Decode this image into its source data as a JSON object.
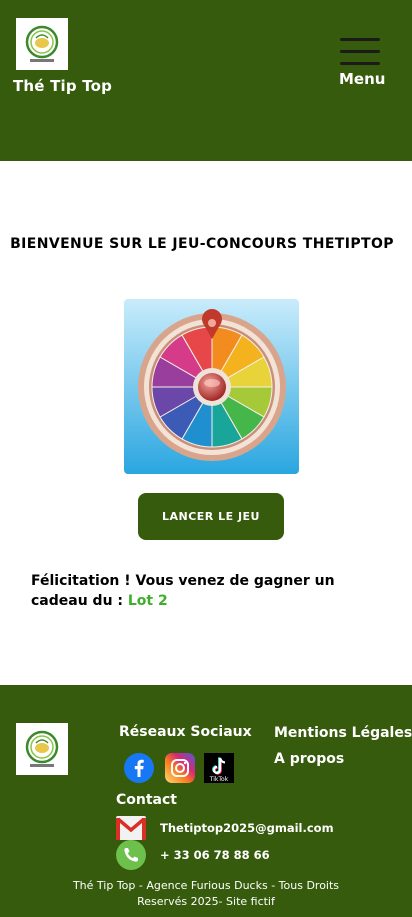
{
  "header": {
    "brand": "Thé Tip Top",
    "menu_label": "Menu"
  },
  "main": {
    "title": "Bienvenue sur le jeu-concours TheTipTop",
    "play_button": "Lancer le jeu",
    "result_prefix": "Félicitation ! Vous venez de gagner un cadeau du : ",
    "result_prize": "Lot 2"
  },
  "footer": {
    "social_heading": "Réseaux Sociaux",
    "social_icons": [
      "facebook-icon",
      "instagram-icon",
      "tiktok-icon"
    ],
    "tiktok_label": "TikTok",
    "legal_link": "Mentions Légales",
    "about_link": "A propos",
    "contact_heading": "Contact",
    "email": "Thetiptop2025@gmail.com",
    "phone": "+ 33 06 78 88 66",
    "copyright": "Thé Tip Top - Agence Furious Ducks - Tous Droits Reservés 2025- Site fictif"
  },
  "colors": {
    "brand_green": "#365B0C",
    "prize_green": "#3FAE2A"
  }
}
